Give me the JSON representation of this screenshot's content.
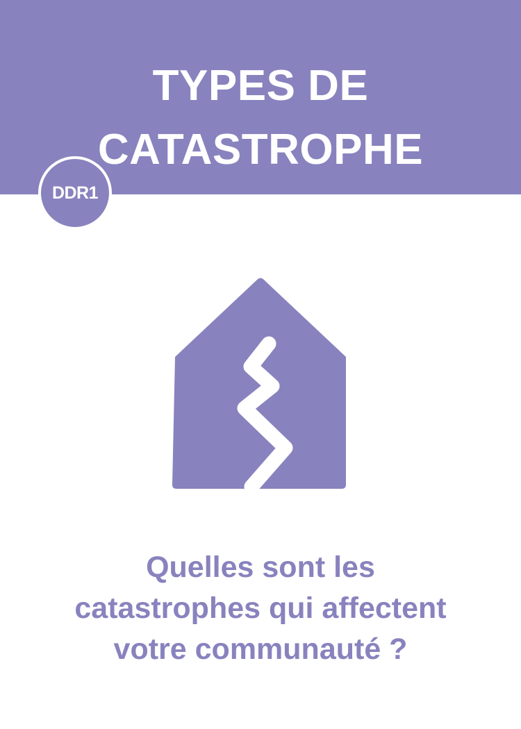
{
  "header": {
    "title_lines": [
      "TYPES DE",
      "CATASTROPHE"
    ],
    "background_color": "#8883BE"
  },
  "badge": {
    "label": "DDR1"
  },
  "illustration": {
    "icon": "house-earthquake-crack-icon",
    "color": "#8883BE"
  },
  "question": {
    "lines": [
      "Quelles sont les",
      "catastrophes qui affectent",
      "votre communauté ?"
    ],
    "color": "#8883BE"
  }
}
